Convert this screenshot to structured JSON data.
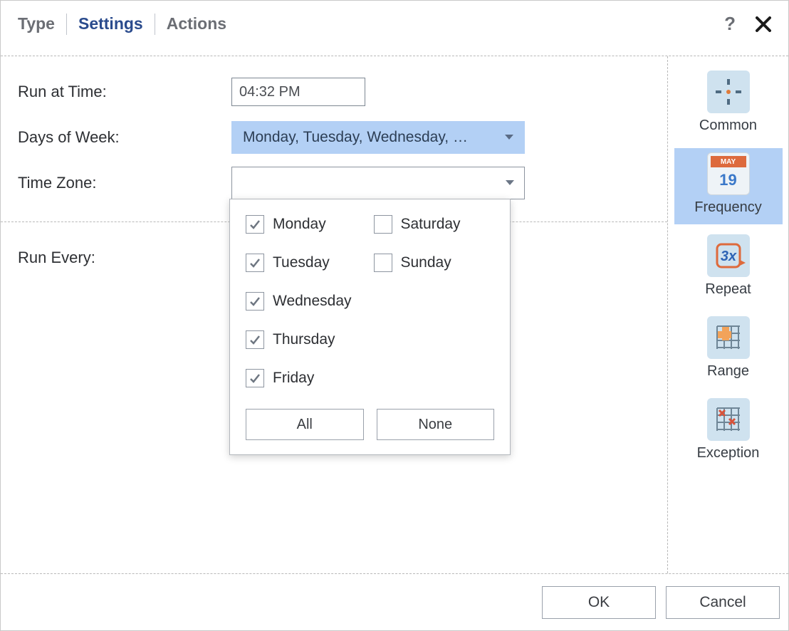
{
  "tabs": {
    "type": "Type",
    "settings": "Settings",
    "actions": "Actions"
  },
  "labels": {
    "run_at": "Run at Time:",
    "days_of_week": "Days of Week:",
    "time_zone": "Time Zone:",
    "run_every": "Run Every:"
  },
  "run_time": "04:32 PM",
  "days_summary": "Monday, Tuesday, Wednesday, …",
  "days": {
    "monday": {
      "label": "Monday",
      "checked": true
    },
    "tuesday": {
      "label": "Tuesday",
      "checked": true
    },
    "wednesday": {
      "label": "Wednesday",
      "checked": true
    },
    "thursday": {
      "label": "Thursday",
      "checked": true
    },
    "friday": {
      "label": "Friday",
      "checked": true
    },
    "saturday": {
      "label": "Saturday",
      "checked": false
    },
    "sunday": {
      "label": "Sunday",
      "checked": false
    }
  },
  "popup": {
    "all": "All",
    "none": "None"
  },
  "side": {
    "common": "Common",
    "frequency": "Frequency",
    "repeat": "Repeat",
    "range": "Range",
    "exception": "Exception",
    "cal_month": "MAY",
    "cal_day": "19",
    "repeat_text": "3x"
  },
  "footer": {
    "ok": "OK",
    "cancel": "Cancel"
  },
  "help_text": "?"
}
